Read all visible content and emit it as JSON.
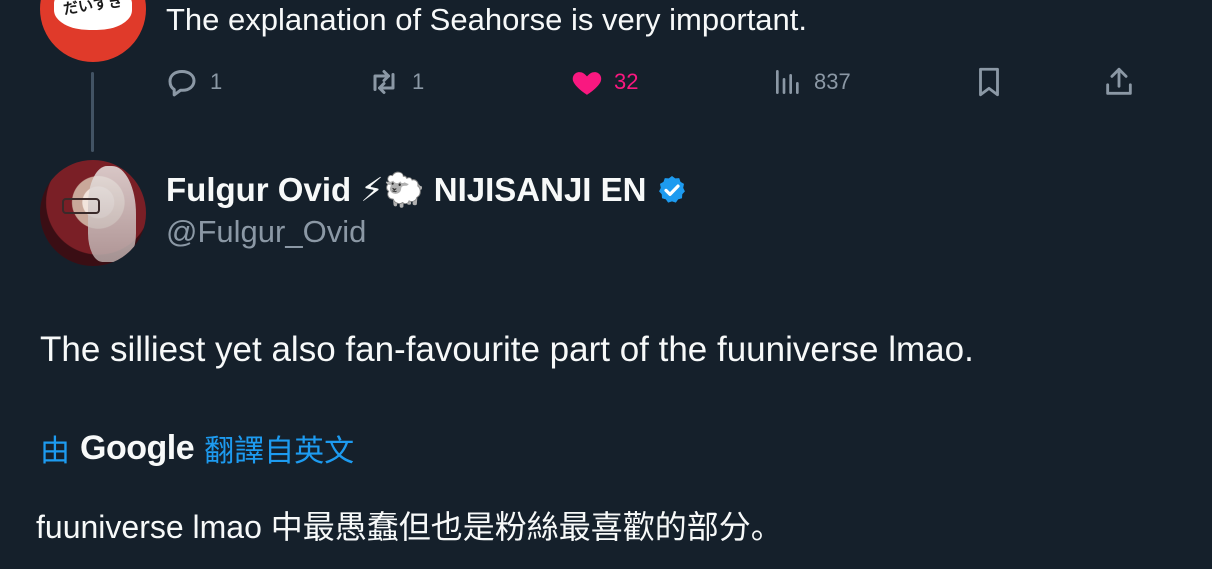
{
  "parent_tweet": {
    "avatar_text": "だいすき",
    "text": "The explanation of Seahorse is very important.",
    "actions": {
      "replies": "1",
      "retweets": "1",
      "likes": "32",
      "views": "837"
    }
  },
  "tweet": {
    "display_name": "Fulgur Ovid ⚡🐑 NIJISANJI EN",
    "handle": "@Fulgur_Ovid",
    "text": "The silliest yet also fan-favourite part of the fuuniverse lmao.",
    "translation": {
      "by_label": "由",
      "provider": "Google",
      "link_label": "翻譯自英文",
      "text": "fuuniverse lmao 中最愚蠢但也是粉絲最喜歡的部分。"
    }
  },
  "colors": {
    "background": "#15202b",
    "text": "#f7f9f9",
    "muted": "#8b98a5",
    "accent": "#1d9bf0",
    "like": "#f91880"
  }
}
